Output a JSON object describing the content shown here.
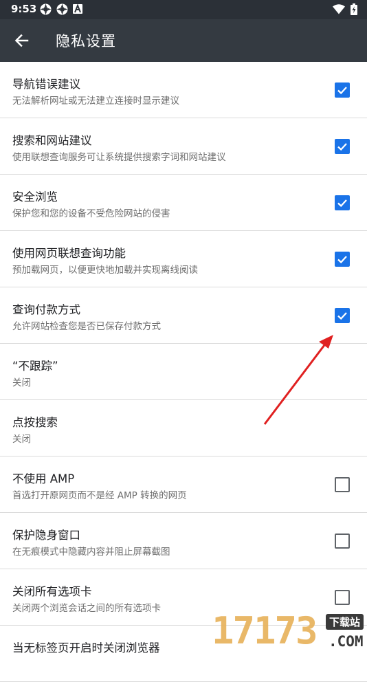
{
  "status_bar": {
    "time": "9:53"
  },
  "app_bar": {
    "title": "隐私设置"
  },
  "settings": [
    {
      "title": "导航错误建议",
      "summary": "无法解析网址或无法建立连接时显示建议",
      "checked": true
    },
    {
      "title": "搜索和网站建议",
      "summary": "使用联想查询服务可让系统提供搜索字词和网站建议",
      "checked": true
    },
    {
      "title": "安全浏览",
      "summary": "保护您和您的设备不受危险网站的侵害",
      "checked": true
    },
    {
      "title": "使用网页联想查询功能",
      "summary": "预加载网页，以便更快地加载并实现离线阅读",
      "checked": true
    },
    {
      "title": "查询付款方式",
      "summary": "允许网站检查您是否已保存付款方式",
      "checked": true
    },
    {
      "title": "“不跟踪”",
      "summary": "关闭"
    },
    {
      "title": "点按搜索",
      "summary": "关闭"
    },
    {
      "title": "不使用 AMP",
      "summary": "首选打开原网页而不是经 AMP 转换的网页",
      "checked": false
    },
    {
      "title": "保护隐身窗口",
      "summary": "在无痕模式中隐藏内容并阻止屏幕截图",
      "checked": false
    },
    {
      "title": "关闭所有选项卡",
      "summary": "关闭两个浏览会话之间的所有选项卡",
      "checked": false
    },
    {
      "title": "当无标签页开启时关闭浏览器",
      "summary": ""
    }
  ],
  "colors": {
    "status_bar_bg": "#2b3037",
    "app_bar_bg": "#343a41",
    "checkbox_checked": "#1a73e8",
    "annotation_arrow": "#e02020"
  },
  "watermark": {
    "digits": "17173",
    "tag": "下载站",
    "domain": ".COM"
  }
}
